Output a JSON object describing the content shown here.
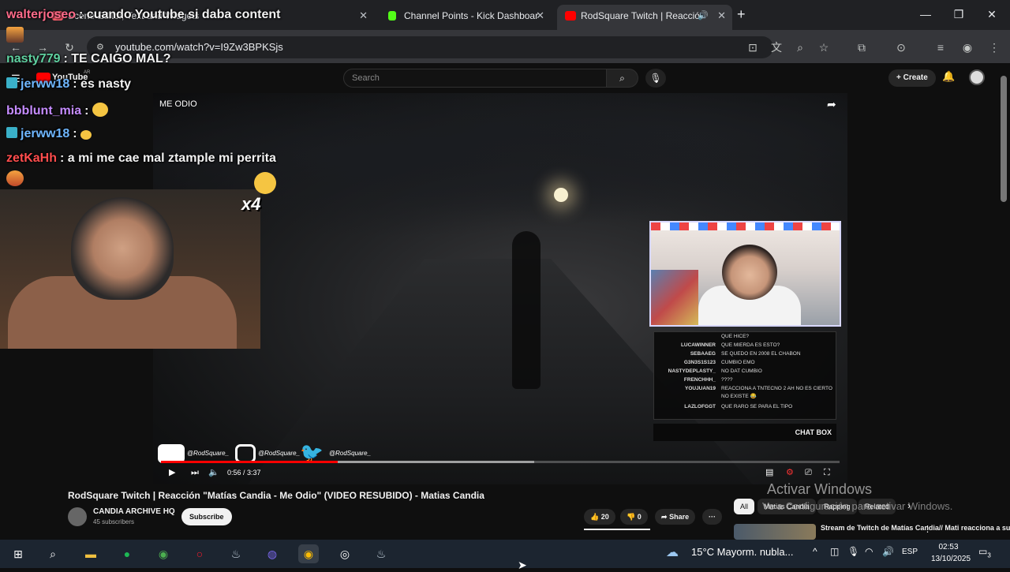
{
  "browser": {
    "tabs": [
      {
        "label": "Scene Editor, Text and Widgets",
        "color": "#ff5f6d"
      },
      {
        "label": "Channel Points - Kick Dashboar",
        "color": "#53fc18"
      },
      {
        "label": "RodSquare Twitch | Reacció",
        "color": "#ff0000"
      }
    ],
    "new_tab": "+",
    "url": "youtube.com/watch?v=I9Zw3BPKSjs",
    "window_controls": [
      "—",
      "❐",
      "✕"
    ]
  },
  "youtube": {
    "logo": "YouTube",
    "logo_region": "AR",
    "search_placeholder": "Search",
    "create_label": "Create"
  },
  "video": {
    "overlay_title": "ME ODIO",
    "time_current": "0:56",
    "time_total": "3:37",
    "progress_played": 0.26,
    "progress_loaded": 0.55,
    "social": [
      "@RodSquare_",
      "@RodSquare_",
      "@RodSquare_"
    ],
    "chatbox_label": "CHAT BOX",
    "chatbox_rows": [
      {
        "user": "",
        "msg": "QUE HICE?"
      },
      {
        "user": "LUCAWINNER",
        "msg": "QUE MIERDA ES ESTO?"
      },
      {
        "user": "SEBAAEG",
        "msg": "SE QUEDO EN 2008 EL CHABON"
      },
      {
        "user": "G3N3S1S123",
        "msg": "CUMBIO EMO"
      },
      {
        "user": "NASTYDEPLASTY_",
        "msg": "NO DAT CUMBIO"
      },
      {
        "user": "FRENCHHH_",
        "msg": "????"
      },
      {
        "user": "YOUJUAN19",
        "msg": "REACCIONA A TNTECNO 2 AH NO ES CIERTO NO EXISTE 😂"
      },
      {
        "user": "LAZLOFGGT",
        "msg": "QUE RARO SE PARA EL TIPO"
      }
    ]
  },
  "below": {
    "title": "RodSquare Twitch | Reacción \"Matías Candia - Me Odio\" (VIDEO RESUBIDO) - Matias Candia",
    "channel": "CANDIA ARCHIVE HQ",
    "subs": "45 subscribers",
    "subscribe": "Subscribe",
    "likes": "20",
    "dislikes": "0",
    "share": "Share",
    "more": "···",
    "chips": [
      "All",
      "Matias Candia",
      "Rapping",
      "Related"
    ],
    "suggestion_title": "Stream de Twitch de Matías Candia// Mati reacciona a su..."
  },
  "windows_watermark": {
    "line1": "Activar Windows",
    "line2": "Ve a Configuración para activar Windows."
  },
  "stream_chat": [
    {
      "user": "walterjoseo",
      "color": "#ff6b8a",
      "msg": ": cuando Youtube si daba content",
      "badge": false
    },
    {
      "user": "nasty779",
      "color": "#5fd1a0",
      "msg": ": TE CAIGO MAL?",
      "badge": false
    },
    {
      "user": "jerww18",
      "color": "#6fb7ff",
      "msg": ": es nasty",
      "badge": true
    },
    {
      "user": "bbblunt_mia",
      "color": "#c58cff",
      "msg": ":",
      "badge": false
    },
    {
      "user": "jerww18",
      "color": "#6fb7ff",
      "msg": ":",
      "badge": true
    },
    {
      "user": "zetKaHh",
      "color": "#ff4d4d",
      "msg": ": a mi me cae mal ztample mi perrita",
      "badge": false
    }
  ],
  "emote_multiplier": "x4",
  "taskbar": {
    "weather": "15°C  Mayorm. nubla...",
    "lang": "ESP",
    "time": "02:53",
    "date": "13/10/2025",
    "notifications": "3"
  }
}
